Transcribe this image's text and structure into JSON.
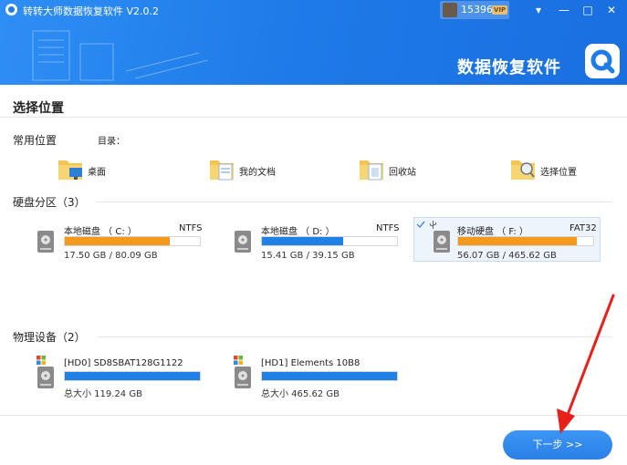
{
  "app": {
    "title": "转转大师数据恢复软件 V2.0.2",
    "user": "15396...",
    "vip": "VIP",
    "brand": "数据恢复软件"
  },
  "window_controls": [
    "▾",
    "—",
    "□",
    "✕"
  ],
  "page_title": "选择位置",
  "common_section": {
    "label": "常用位置",
    "dir_label": "目录："
  },
  "locations": [
    {
      "label": "桌面",
      "icon": "desktop-folder-icon"
    },
    {
      "label": "我的文档",
      "icon": "documents-folder-icon"
    },
    {
      "label": "回收站",
      "icon": "recycle-bin-folder-icon"
    },
    {
      "label": "选择位置",
      "icon": "choose-location-folder-icon"
    }
  ],
  "disk_section": {
    "label": "硬盘分区（3）"
  },
  "drives": [
    {
      "name": "本地磁盘 （ C: ）",
      "fs": "NTFS",
      "size": "17.50 GB / 80.09 GB",
      "used_fraction": 0.78,
      "color": "#f39a1e",
      "selected": false
    },
    {
      "name": "本地磁盘 （ D: ）",
      "fs": "NTFS",
      "size": "15.41 GB / 39.15 GB",
      "used_fraction": 0.6,
      "color": "#1f80e6",
      "selected": false
    },
    {
      "name": "移动硬盘 （ F: ）",
      "fs": "FAT32",
      "size": "56.07 GB / 465.62 GB",
      "used_fraction": 0.88,
      "color": "#f39a1e",
      "selected": true
    }
  ],
  "device_section": {
    "label": "物理设备（2）"
  },
  "devices": [
    {
      "name": "[HD0] SD8SBAT128G1122",
      "size": "总大小 119.24 GB",
      "used_fraction": 1.0,
      "color": "#1f80e6"
    },
    {
      "name": "[HD1] Elements 10B8",
      "size": "总大小 465.62 GB",
      "used_fraction": 1.0,
      "color": "#1f80e6"
    }
  ],
  "next_button": "下一步 >>"
}
